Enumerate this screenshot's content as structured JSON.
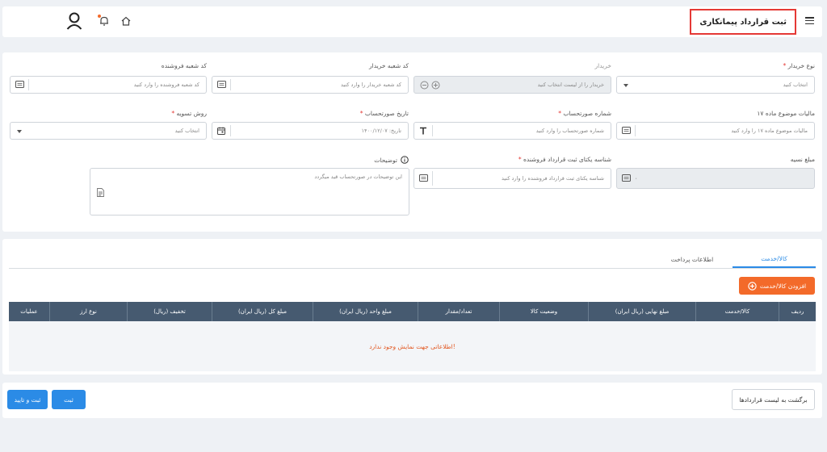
{
  "header": {
    "title": "ثبت قرارداد پیمانکاری",
    "icons": [
      "menu-icon",
      "user-icon",
      "notification-icon",
      "home-icon"
    ]
  },
  "form": {
    "buyer_type": {
      "label": "نوع خریدار",
      "placeholder": "انتخاب کنید"
    },
    "buyer": {
      "label": "خریدار",
      "placeholder": "خریدار را از لیست انتخاب کنید"
    },
    "buyer_branch": {
      "label": "کد شعبه خریدار",
      "placeholder": "کد شعبه خریدار را وارد کنید"
    },
    "seller_branch": {
      "label": "کد شعبه فروشنده",
      "placeholder": "کد شعبه فروشنده را وارد کنید"
    },
    "tax17": {
      "label": "مالیات موضوع ماده ۱۷",
      "placeholder": "مالیات موضوع ماده ۱۷ را وارد کنید"
    },
    "invoice_number": {
      "label": "شماره صورتحساب",
      "placeholder": "شماره صورتحساب را وارد کنید"
    },
    "invoice_date": {
      "label": "تاریخ صورتحساب",
      "placeholder": "تاریخ: ۱۴۰۰/۱۲/۰۷"
    },
    "settlement": {
      "label": "روش تسویه",
      "placeholder": "انتخاب کنید"
    },
    "credit_amount": {
      "label": "مبلغ نسیه",
      "value": "۰"
    },
    "seller_contract_id": {
      "label": "شناسه یکتای ثبت قرارداد فروشنده",
      "placeholder": "شناسه یکتای ثبت قرارداد فروشنده را وارد کنید"
    },
    "description": {
      "label": "توضیحات",
      "placeholder": "این توضیحات در صورتحساب قید میگردد"
    },
    "required_mark": "*"
  },
  "tabs": [
    {
      "label": "کالا/خدمت",
      "active": true
    },
    {
      "label": "اطلاعات پرداخت",
      "active": false
    }
  ],
  "add_button": "افزودن کالا/خدمت",
  "table": {
    "columns": [
      "ردیف",
      "کالا/خدمت",
      "مبلغ نهایی (ریال ایران)",
      "وضعیت کالا",
      "تعداد/مقدار",
      "مبلغ واحد (ریال ایران)",
      "مبلغ کل (ریال ایران)",
      "تخفیف (ریال)",
      "نوع ارز",
      "عملیات"
    ],
    "empty_message": "اطلاعاتی جهت نمایش وجود ندارد!"
  },
  "footer": {
    "back": "برگشت به لیست قراردادها",
    "save": "ثبت",
    "save_confirm": "ثبت و تایید"
  },
  "colors": {
    "accent": "#2b8be6",
    "orange": "#f36a2a",
    "table_header": "#465a70",
    "highlight": "#e53935"
  }
}
